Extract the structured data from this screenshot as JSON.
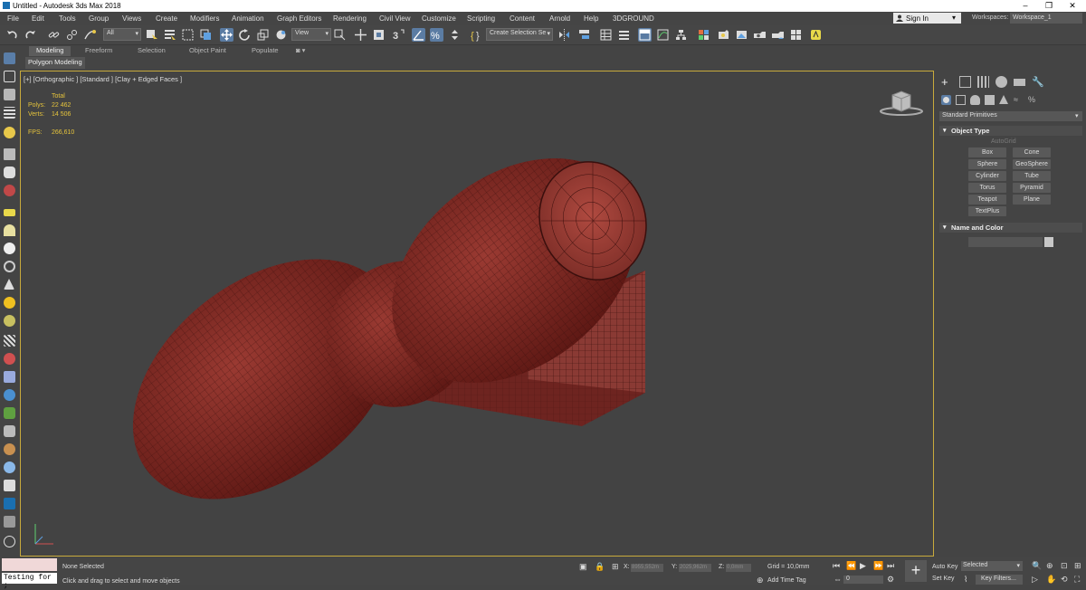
{
  "window": {
    "title": "Untitled - Autodesk 3ds Max 2018"
  },
  "menus": [
    "File",
    "Edit",
    "Tools",
    "Group",
    "Views",
    "Create",
    "Modifiers",
    "Animation",
    "Graph Editors",
    "Rendering",
    "Civil View",
    "Customize",
    "Scripting",
    "Content",
    "Arnold",
    "Help",
    "3DGROUND"
  ],
  "account": {
    "signin": "Sign In",
    "workspaces_label": "Workspaces:",
    "workspace": "Workspace_1"
  },
  "toolbar": {
    "selection_filter": "All",
    "ref_coord": "View",
    "named_selection": "Create Selection Se"
  },
  "ribbon": {
    "tabs": [
      "Modeling",
      "Freeform",
      "Selection",
      "Object Paint",
      "Populate"
    ],
    "active_tab": "Modeling",
    "panel": "Polygon Modeling"
  },
  "viewport": {
    "label": "[+] [Orthographic ] [Standard ] [Clay + Edged Faces ]",
    "stats": {
      "total_label": "Total",
      "polys_label": "Polys:",
      "polys": "22 462",
      "verts_label": "Verts:",
      "verts": "14 506",
      "fps_label": "FPS:",
      "fps": "266,610"
    },
    "object_color": "#7a2420",
    "border_color": "#c8aa3c"
  },
  "command_panel": {
    "category": "Standard Primitives",
    "object_type": "Object Type",
    "autogrid": "AutoGrid",
    "buttons": [
      "Box",
      "Cone",
      "Sphere",
      "GeoSphere",
      "Cylinder",
      "Tube",
      "Torus",
      "Pyramid",
      "Teapot",
      "Plane",
      "TextPlus"
    ],
    "name_and_color": "Name and Color"
  },
  "status": {
    "maxscript_value": "Testing for ;",
    "selection": "None Selected",
    "prompt": "Click and drag to select and move objects",
    "x_label": "X:",
    "x": "8955,552m",
    "y_label": "Y:",
    "y": "2025,962m",
    "z_label": "Z:",
    "z": "0,0mm",
    "grid": "Grid = 10,0mm",
    "add_time_tag": "Add Time Tag",
    "frame": "0",
    "auto_key": "Auto Key",
    "set_key": "Set Key",
    "key_mode": "Selected",
    "key_filters": "Key Filters..."
  }
}
